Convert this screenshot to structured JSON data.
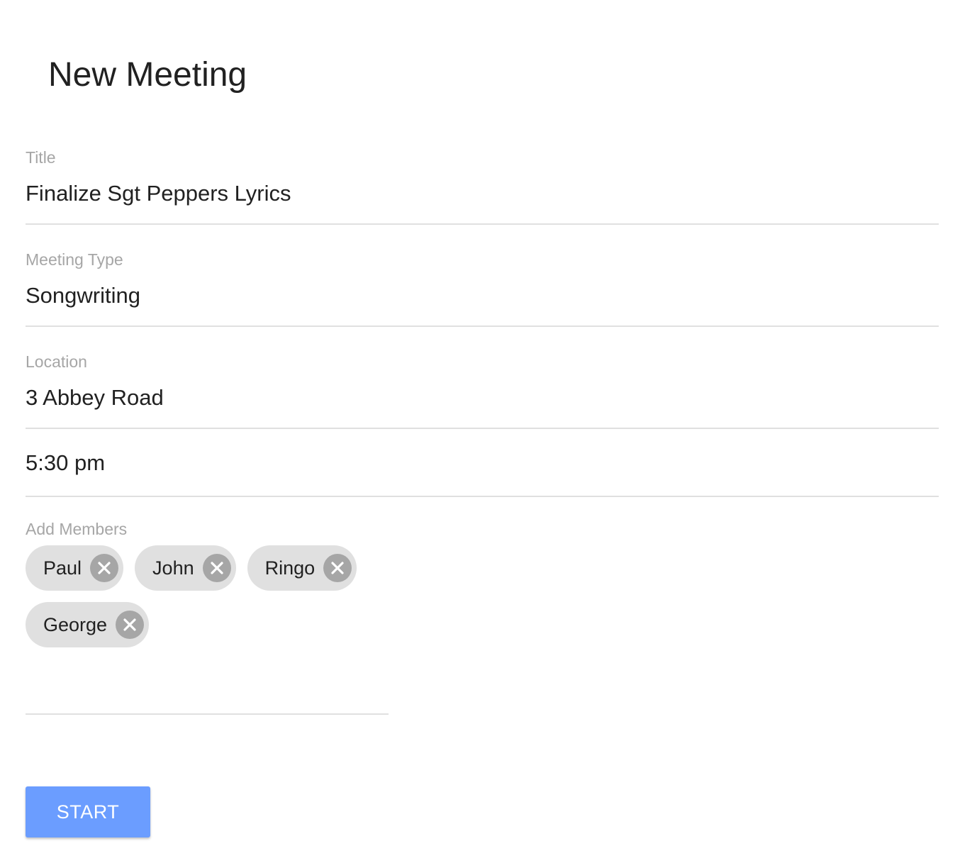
{
  "page": {
    "title": "New Meeting"
  },
  "form": {
    "title": {
      "label": "Title",
      "value": "Finalize Sgt Peppers Lyrics"
    },
    "meeting_type": {
      "label": "Meeting Type",
      "value": "Songwriting"
    },
    "location": {
      "label": "Location",
      "value": "3 Abbey Road"
    },
    "time": {
      "value": "5:30 pm"
    },
    "members": {
      "label": "Add Members",
      "chips": [
        "Paul",
        "John",
        "Ringo",
        "George"
      ]
    }
  },
  "actions": {
    "start_label": "START"
  },
  "colors": {
    "accent": "#6b9dff",
    "chip_bg": "#e0e0e0",
    "chip_icon": "#a6a6a6",
    "label": "#a6a6a6"
  },
  "icons": {
    "chip_remove": "close-circle-icon"
  }
}
